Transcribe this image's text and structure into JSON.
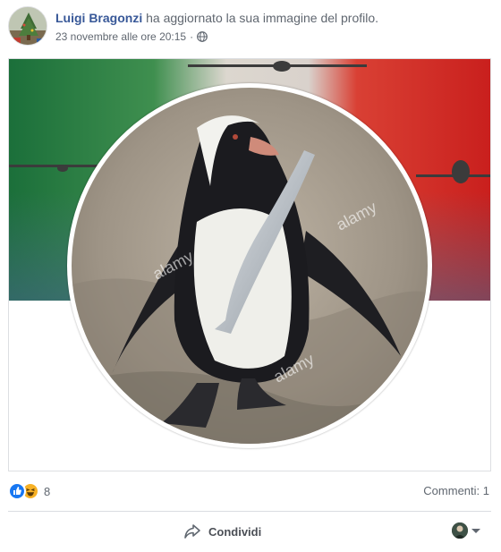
{
  "post": {
    "author_name": "Luigi Bragonzi",
    "action_text": "ha aggiornato la sua immagine del profilo.",
    "timestamp": "23 novembre alle ore 20:15",
    "separator": "·",
    "privacy_icon": "globe-icon",
    "watermark": "alamy"
  },
  "reactions": {
    "types": [
      "like-icon",
      "haha-icon"
    ],
    "count": "8",
    "comments_label": "Commenti: 1"
  },
  "actions": {
    "share_label": "Condividi",
    "share_icon": "share-arrow-icon",
    "viewer_icon": "caret-down-icon"
  },
  "colors": {
    "link": "#385898",
    "meta": "#606770",
    "like": "#1877f2",
    "haha": "#f7b125",
    "flag_green": "#1e7a3c",
    "flag_red": "#d62a24"
  }
}
